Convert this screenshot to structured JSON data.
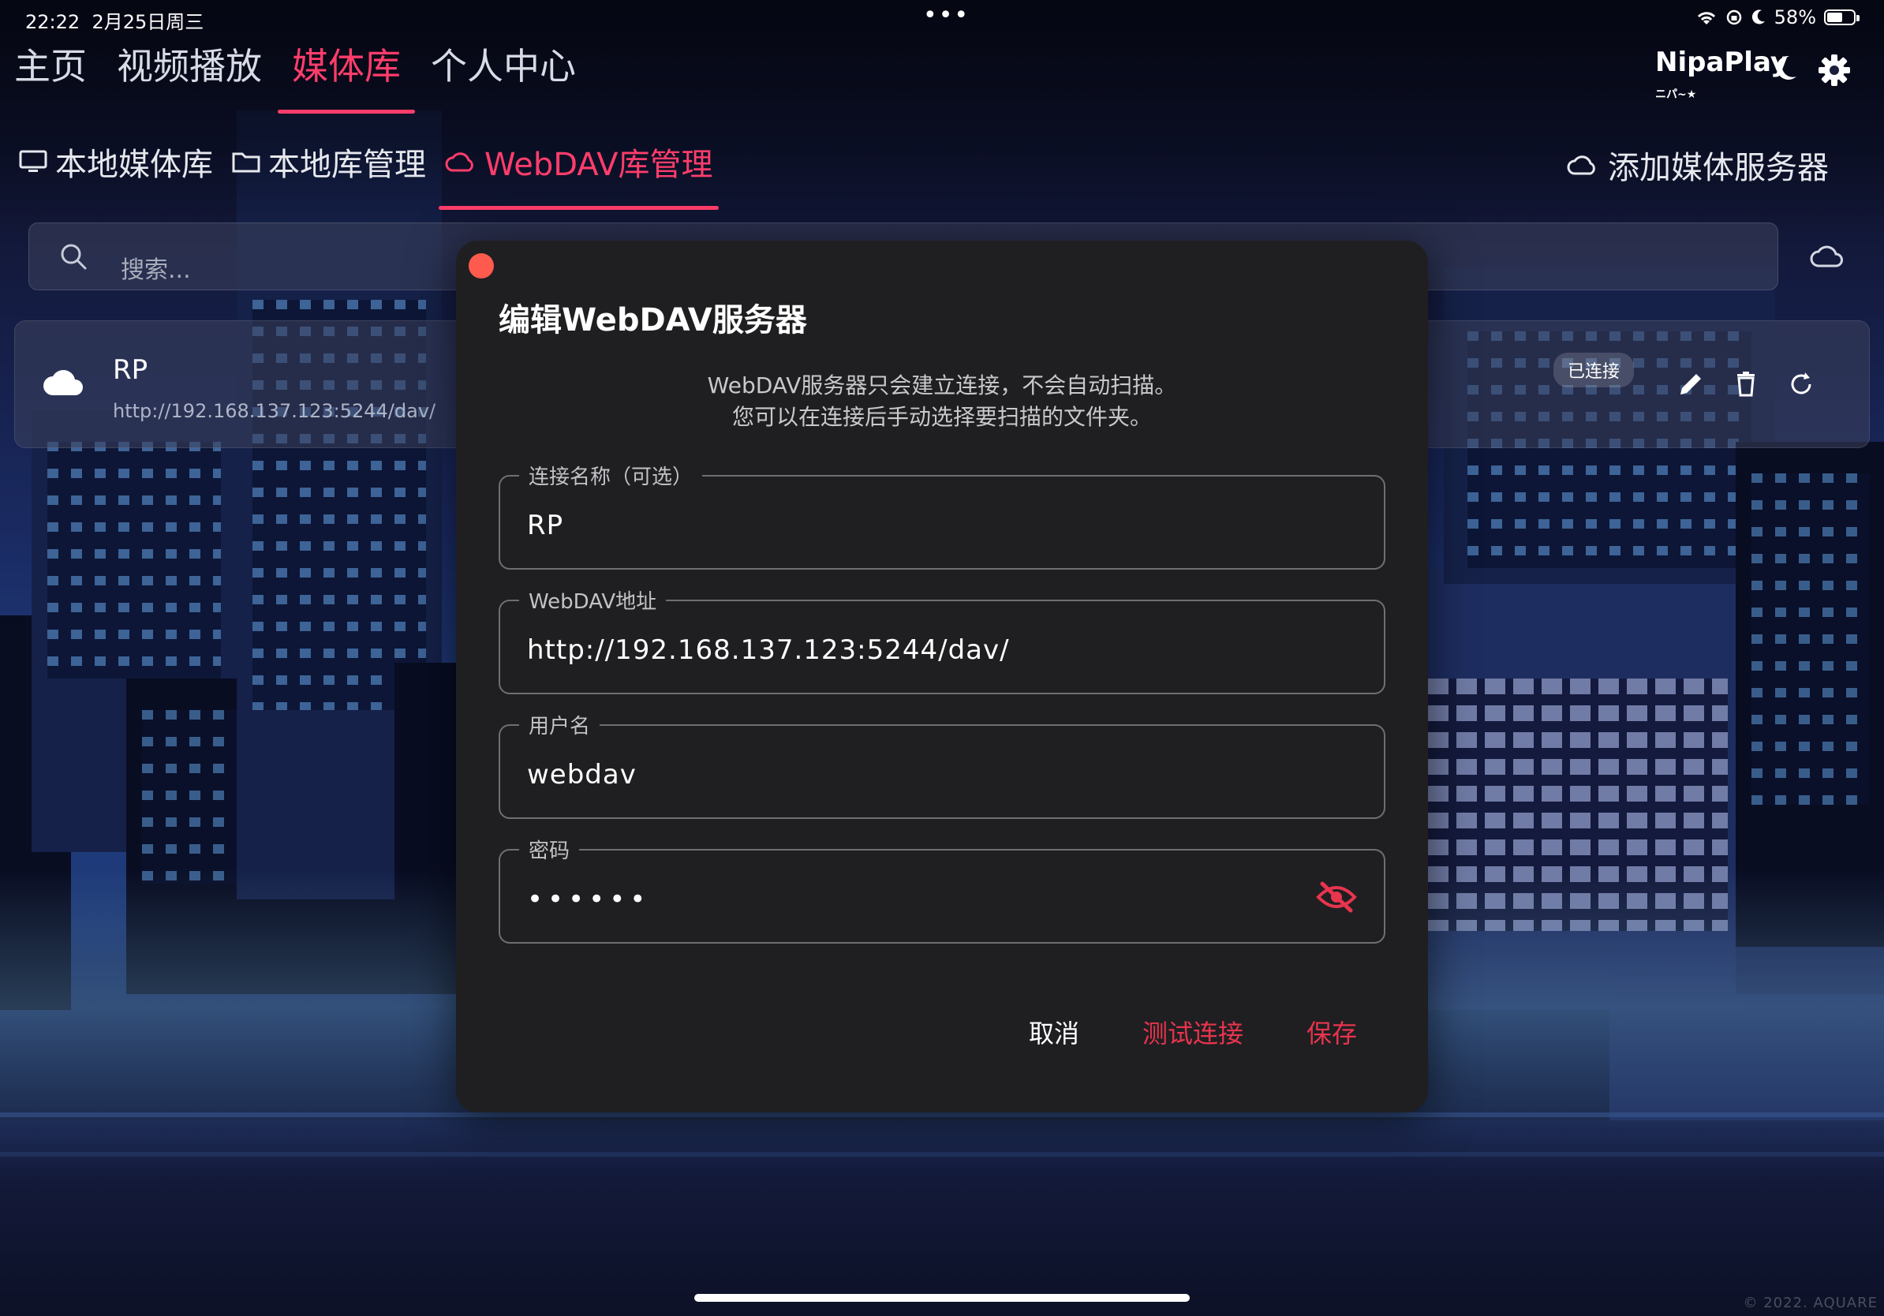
{
  "status": {
    "time": "22:22",
    "date": "2月25日周三",
    "battery": "58%",
    "battery_level": 0.58,
    "dots": "•••"
  },
  "nav": {
    "tabs": [
      {
        "label": "主页"
      },
      {
        "label": "视频播放"
      },
      {
        "label": "媒体库"
      },
      {
        "label": "个人中心"
      }
    ],
    "active_index": 2,
    "logo_main": "NipaPlay",
    "logo_top": "ニパ~★"
  },
  "subnav": {
    "tabs": [
      {
        "label": "本地媒体库",
        "icon": "monitor-icon"
      },
      {
        "label": "本地库管理",
        "icon": "folder-icon"
      },
      {
        "label": "WebDAV库管理",
        "icon": "cloud-icon"
      }
    ],
    "active_index": 2,
    "add_server_label": "添加媒体服务器"
  },
  "search": {
    "placeholder": "搜索..."
  },
  "server": {
    "name": "RP",
    "url": "http://192.168.137.123:5244/dav/",
    "status": "已连接"
  },
  "dialog": {
    "title": "编辑WebDAV服务器",
    "desc_line1": "WebDAV服务器只会建立连接，不会自动扫描。",
    "desc_line2": "您可以在连接后手动选择要扫描的文件夹。",
    "fields": [
      {
        "label": "连接名称（可选）",
        "value": "RP"
      },
      {
        "label": "WebDAV地址",
        "value": "http://192.168.137.123:5244/dav/"
      },
      {
        "label": "用户名",
        "value": "webdav"
      },
      {
        "label": "密码",
        "value": "••••••"
      }
    ],
    "cancel_label": "取消",
    "test_label": "测试连接",
    "save_label": "保存"
  },
  "footer": {
    "copyright": "© 2022. AQUARE"
  },
  "colors": {
    "accent": "#ff3d6b",
    "dialog_bg": "#1f1f21",
    "danger_text": "#e8344e",
    "close_dot": "#ff5a4e"
  }
}
